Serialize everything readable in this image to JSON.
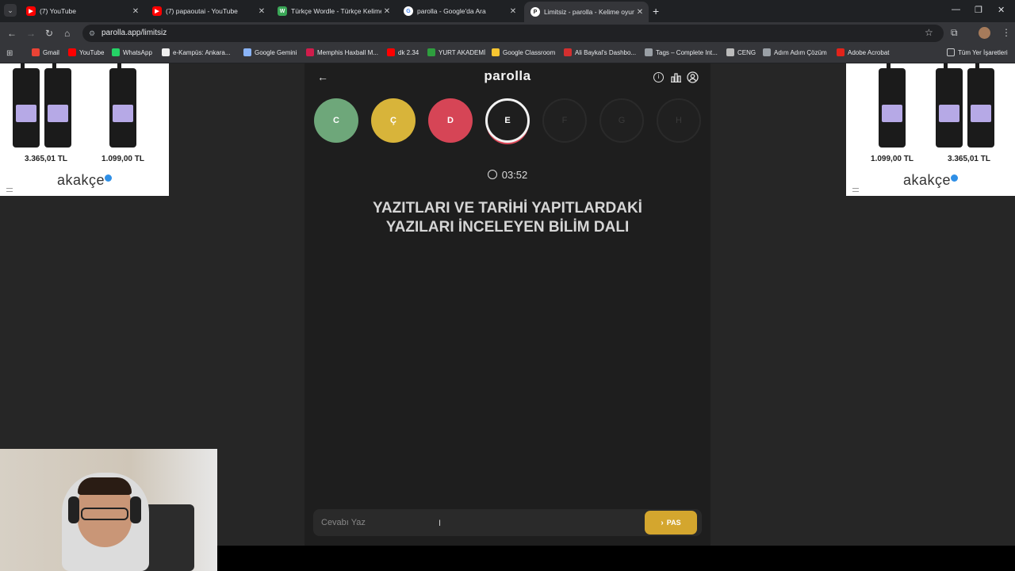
{
  "browser": {
    "tabs": [
      {
        "label": "(7) YouTube",
        "fav": "yt",
        "favText": "▶"
      },
      {
        "label": "(7) papaoutai - YouTube",
        "fav": "yt",
        "favText": "▶"
      },
      {
        "label": "Türkçe Wordle - Türkçe Kelime",
        "fav": "w",
        "favText": "W"
      },
      {
        "label": "parolla - Google'da Ara",
        "fav": "g",
        "favText": "G"
      },
      {
        "label": "Limitsiz - parolla - Kelime oyun",
        "fav": "p",
        "favText": "P"
      }
    ],
    "close_glyph": "✕",
    "new_tab_glyph": "+",
    "url": "parolla.app/limitsiz",
    "window_controls": {
      "minimize": "—",
      "restore": "❐",
      "close": "✕"
    }
  },
  "bookmarks": [
    {
      "label": "Gmail",
      "color": "#ea4335"
    },
    {
      "label": "YouTube",
      "color": "#ff0000"
    },
    {
      "label": "WhatsApp",
      "color": "#25d366"
    },
    {
      "label": "e-Kampüs: Ankara...",
      "color": "#eeeeee"
    },
    {
      "label": "Google Gemini",
      "color": "#8ab4f8"
    },
    {
      "label": "Memphis Haxball M...",
      "color": "#d01c4b"
    },
    {
      "label": "dk 2.34",
      "color": "#ff0000"
    },
    {
      "label": "YURT AKADEMİ",
      "color": "#2e9e3e"
    },
    {
      "label": "Google Classroom",
      "color": "#f7c531"
    },
    {
      "label": "Ali Baykal's Dashbo...",
      "color": "#d32f2f"
    },
    {
      "label": "Tags – Complete Int...",
      "color": "#9aa0a6"
    },
    {
      "label": "CENG",
      "color": "#bbbbbb"
    },
    {
      "label": "Adım Adım Çözüm",
      "color": "#9aa0a6"
    },
    {
      "label": "Adobe Acrobat",
      "color": "#e2231a"
    }
  ],
  "bookmarks_all": "Tüm Yer İşaretleri",
  "ads": {
    "left": {
      "prices": [
        "3.365,01 TL",
        "1.099,00 TL"
      ]
    },
    "right": {
      "prices": [
        "1.099,00 TL",
        "3.365,01 TL"
      ]
    },
    "brand": "akakçe"
  },
  "game": {
    "logo": "parolla",
    "back_glyph": "←",
    "header_icons": [
      "info-icon",
      "stats-icon",
      "user-icon"
    ],
    "letters": [
      {
        "char": "C",
        "state": "green"
      },
      {
        "char": "Ç",
        "state": "yellow"
      },
      {
        "char": "D",
        "state": "red"
      },
      {
        "char": "E",
        "state": "current"
      },
      {
        "char": "F",
        "state": "pending"
      },
      {
        "char": "G",
        "state": "pending"
      },
      {
        "char": "H",
        "state": "pending"
      }
    ],
    "timer": "03:52",
    "question_line1": "YAZITLARI VE TARİHİ YAPITLARDAKİ",
    "question_line2": "YAZILARI İNCELEYEN BİLİM DALI",
    "answer_placeholder": "Cevabı Yaz",
    "pass_label": "PAS",
    "colors": {
      "green": "#6ea77a",
      "yellow": "#d8b43a",
      "red": "#d64556",
      "pass": "#d4a62e"
    }
  }
}
